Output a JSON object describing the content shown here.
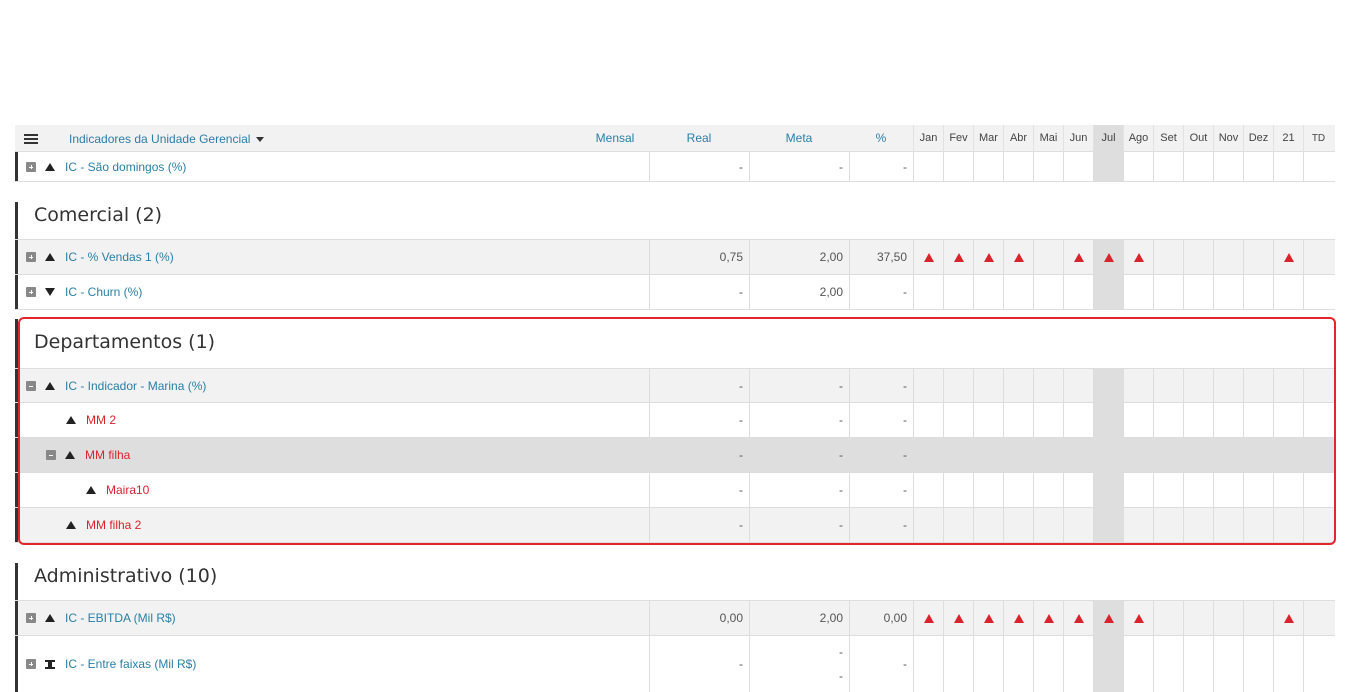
{
  "header": {
    "menu_icon": "hamburger-menu-icon",
    "title": "Indicadores da Unidade Gerencial",
    "mensal": "Mensal",
    "real": "Real",
    "meta": "Meta",
    "pct": "%",
    "months": [
      "Jan",
      "Fev",
      "Mar",
      "Abr",
      "Mai",
      "Jun",
      "Jul",
      "Ago",
      "Set",
      "Out",
      "Nov",
      "Dez",
      "21",
      "TD"
    ]
  },
  "rows": {
    "sao_domingos": {
      "label": "IC - São domingos (%)",
      "real": "-",
      "meta": "-",
      "pct": "-"
    },
    "comercial": {
      "title": "Comercial (2)"
    },
    "vendas": {
      "label": "IC - % Vendas 1 (%)",
      "real": "0,75",
      "meta": "2,00",
      "pct": "37,50"
    },
    "churn": {
      "label": "IC - Churn (%)",
      "real": "-",
      "meta": "2,00",
      "pct": "-"
    },
    "departamentos": {
      "title": "Departamentos (1)"
    },
    "marina": {
      "label": "IC - Indicador - Marina (%)",
      "real": "-",
      "meta": "-",
      "pct": "-"
    },
    "mm2": {
      "label": "MM 2",
      "real": "-",
      "meta": "-",
      "pct": "-"
    },
    "mmfilha": {
      "label": "MM filha",
      "real": "-",
      "meta": "-",
      "pct": "-"
    },
    "maira10": {
      "label": "Maira10",
      "real": "-",
      "meta": "-",
      "pct": "-"
    },
    "mmfilha2": {
      "label": "MM filha 2",
      "real": "-",
      "meta": "-",
      "pct": "-"
    },
    "administrativo": {
      "title": "Administrativo (10)"
    },
    "ebitda": {
      "label": "IC - EBITDA (Mil R$)",
      "real": "0,00",
      "meta": "2,00",
      "pct": "0,00"
    },
    "entre_faixas": {
      "label": "IC - Entre faixas (Mil R$)",
      "real": "-",
      "meta1": "-",
      "meta2": "-",
      "pct": "-"
    }
  },
  "colors": {
    "accent": "#2a7fa5",
    "alert": "#d9232d",
    "highlight_border": "#e3262d"
  }
}
